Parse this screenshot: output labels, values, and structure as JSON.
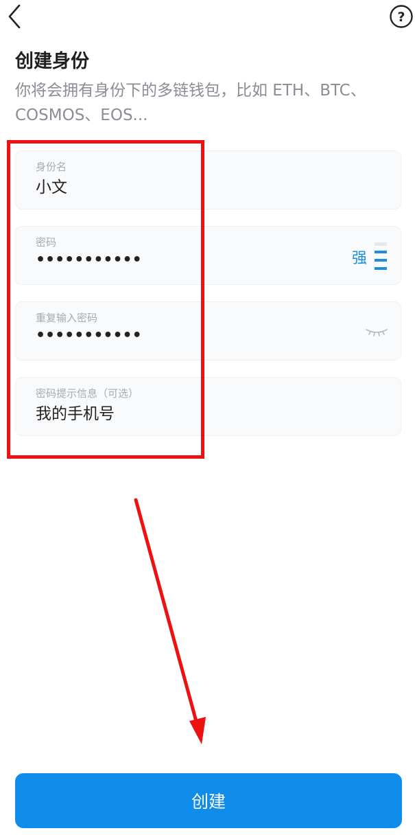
{
  "header": {
    "back_icon": "chevron-left-icon",
    "help_icon": "question-circle-icon",
    "help_glyph": "?"
  },
  "page": {
    "title": "创建身份",
    "subtitle": "你将会拥有身份下的多链钱包，比如 ETH、BTC、COSMOS、EOS..."
  },
  "form": {
    "identity_name": {
      "label": "身份名",
      "value": "小文"
    },
    "password": {
      "label": "密码",
      "value": "•••••••••••",
      "strength_label": "强",
      "strength_level": 3,
      "strength_max": 4
    },
    "repeat_password": {
      "label": "重复输入密码",
      "value": "•••••••••••",
      "toggle_icon": "eye-closed-icon"
    },
    "hint": {
      "label": "密码提示信息（可选）",
      "value": "我的手机号"
    }
  },
  "actions": {
    "create_label": "创建"
  },
  "colors": {
    "accent": "#108cea",
    "annotation": "#ee1111",
    "field_bg": "#f9fafc",
    "muted_text": "#8a8d96"
  }
}
